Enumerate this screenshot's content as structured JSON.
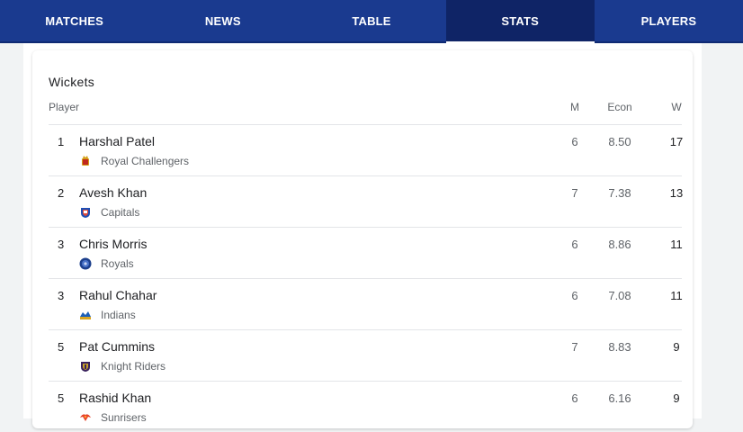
{
  "nav": {
    "tabs": [
      {
        "label": "MATCHES",
        "active": false
      },
      {
        "label": "NEWS",
        "active": false
      },
      {
        "label": "TABLE",
        "active": false
      },
      {
        "label": "STATS",
        "active": true
      },
      {
        "label": "PLAYERS",
        "active": false
      }
    ]
  },
  "card": {
    "title": "Wickets",
    "columns": {
      "player": "Player",
      "m": "M",
      "econ": "Econ",
      "w": "W"
    },
    "rows": [
      {
        "rank": "1",
        "player": "Harshal Patel",
        "team": "Royal Challengers",
        "team_icon": "royal-challengers-logo-icon",
        "m": "6",
        "econ": "8.50",
        "w": "17"
      },
      {
        "rank": "2",
        "player": "Avesh Khan",
        "team": "Capitals",
        "team_icon": "capitals-logo-icon",
        "m": "7",
        "econ": "7.38",
        "w": "13"
      },
      {
        "rank": "3",
        "player": "Chris Morris",
        "team": "Royals",
        "team_icon": "royals-logo-icon",
        "m": "6",
        "econ": "8.86",
        "w": "11"
      },
      {
        "rank": "3",
        "player": "Rahul Chahar",
        "team": "Indians",
        "team_icon": "indians-logo-icon",
        "m": "6",
        "econ": "7.08",
        "w": "11"
      },
      {
        "rank": "5",
        "player": "Pat Cummins",
        "team": "Knight Riders",
        "team_icon": "knight-riders-logo-icon",
        "m": "7",
        "econ": "8.83",
        "w": "9"
      },
      {
        "rank": "5",
        "player": "Rashid Khan",
        "team": "Sunrisers",
        "team_icon": "sunrisers-logo-icon",
        "m": "6",
        "econ": "6.16",
        "w": "9"
      }
    ]
  },
  "colors": {
    "nav_bg": "#1a3a8f",
    "nav_active": "#0f2466"
  }
}
